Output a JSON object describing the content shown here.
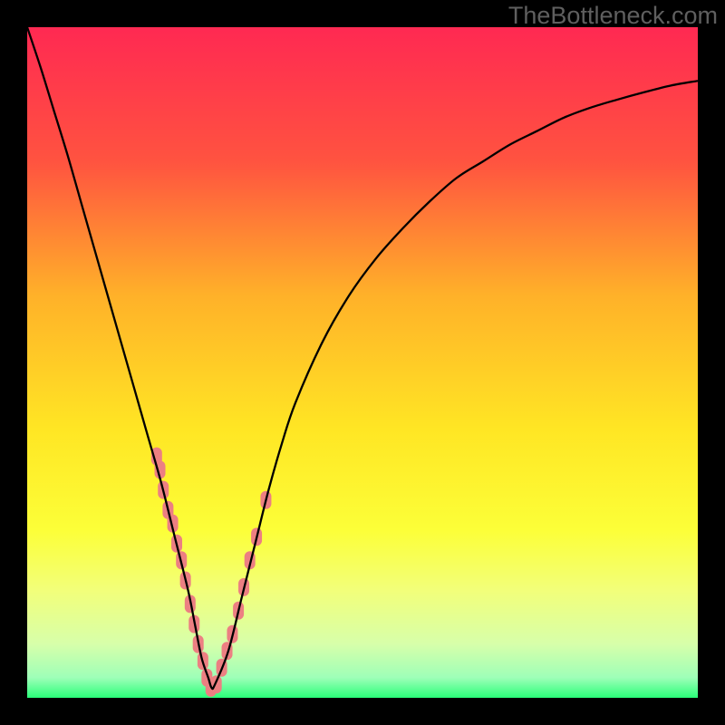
{
  "watermark": "TheBottleneck.com",
  "chart_data": {
    "type": "line",
    "title": "",
    "xlabel": "",
    "ylabel": "",
    "xlim": [
      0,
      100
    ],
    "ylim": [
      0,
      100
    ],
    "grid": false,
    "background_gradient": {
      "stops": [
        {
          "offset": 0.0,
          "color": "#ff2952"
        },
        {
          "offset": 0.2,
          "color": "#ff5340"
        },
        {
          "offset": 0.4,
          "color": "#ffb129"
        },
        {
          "offset": 0.6,
          "color": "#ffe624"
        },
        {
          "offset": 0.75,
          "color": "#fcff38"
        },
        {
          "offset": 0.84,
          "color": "#f2ff7a"
        },
        {
          "offset": 0.92,
          "color": "#d7ffaa"
        },
        {
          "offset": 0.97,
          "color": "#9effb8"
        },
        {
          "offset": 1.0,
          "color": "#2aff79"
        }
      ]
    },
    "series": [
      {
        "name": "bottleneck-curve",
        "color": "#000000",
        "x": [
          0,
          2,
          4,
          6,
          8,
          10,
          12,
          14,
          16,
          18,
          20,
          22,
          24,
          25,
          26,
          27,
          27.5,
          28,
          30,
          32,
          34,
          36,
          38,
          40,
          44,
          48,
          52,
          56,
          60,
          64,
          68,
          72,
          76,
          80,
          84,
          88,
          92,
          96,
          100
        ],
        "y": [
          100,
          94,
          87.5,
          81,
          74,
          67,
          60,
          53,
          46,
          39,
          32,
          24,
          16,
          11,
          6,
          3,
          1.5,
          2,
          7,
          15,
          23,
          31,
          38,
          44,
          53,
          60,
          65.5,
          70,
          74,
          77.5,
          80,
          82.5,
          84.5,
          86.5,
          88,
          89.2,
          90.3,
          91.3,
          92
        ]
      }
    ],
    "scatter_points": {
      "name": "highlighted-points",
      "color": "#ec7f82",
      "x": [
        19.3,
        19.8,
        20.3,
        21.0,
        21.7,
        22.3,
        23.0,
        23.6,
        24.3,
        24.9,
        25.5,
        26.2,
        26.8,
        27.4,
        28.2,
        29.0,
        29.8,
        30.6,
        31.5,
        32.3,
        33.2,
        34.2,
        35.6
      ],
      "y": [
        36.0,
        34.0,
        31.0,
        28.0,
        26.0,
        23.0,
        20.5,
        17.5,
        14.0,
        11.0,
        8.0,
        5.5,
        3.0,
        1.5,
        2.0,
        4.5,
        7.0,
        9.5,
        13.0,
        16.5,
        20.5,
        24.0,
        29.5
      ]
    }
  }
}
